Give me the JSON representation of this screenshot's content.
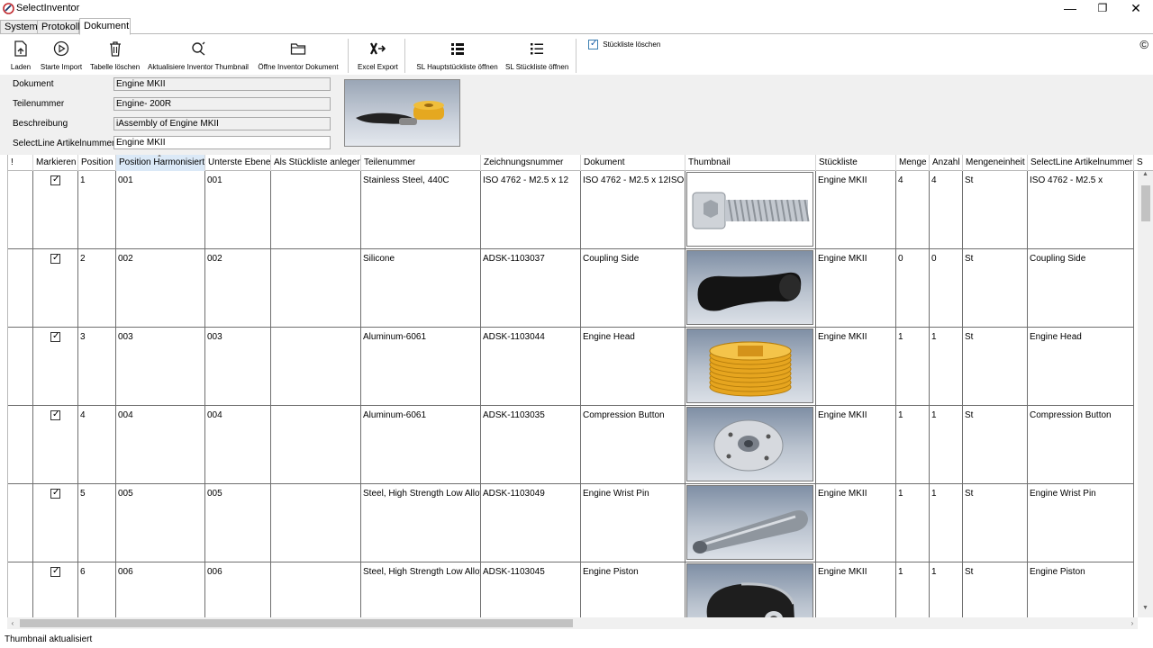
{
  "window": {
    "title": "SelectInventor",
    "minimize": "—",
    "maximize": "❐",
    "close": "✕"
  },
  "tabs": [
    {
      "label": "System"
    },
    {
      "label": "Protokoll"
    },
    {
      "label": "Dokument"
    }
  ],
  "toolbar": {
    "laden": "Laden",
    "starte_import": "Starte Import",
    "tabelle_loeschen": "Tabelle löschen",
    "aktualisiere_thumbnail": "Aktualisiere Inventor Thumbnail",
    "oeffne_dokument": "Öffne Inventor Dokument",
    "excel_export": "Excel Export",
    "sl_hauptstueckliste": "SL Hauptstückliste öffnen",
    "sl_stueckliste": "SL Stückliste öffnen",
    "stueckliste_loeschen": "Stückliste löschen",
    "stueckliste_loeschen_checked": true,
    "copyright": "©"
  },
  "fields": {
    "dokument_label": "Dokument",
    "dokument_value": "Engine MKII",
    "teilenummer_label": "Teilenummer",
    "teilenummer_value": "Engine- 200R",
    "beschreibung_label": "Beschreibung",
    "beschreibung_value": "iAssembly of Engine MKII",
    "artikelnummer_label": "SelectLine Artikelnummer",
    "artikelnummer_value": "Engine MKII"
  },
  "grid": {
    "columns": [
      "!",
      "Markieren",
      "Position",
      "Position Harmonisiert",
      "Unterste Ebene",
      "Als Stückliste anlegen",
      "Teilenummer",
      "Zeichnungsnummer",
      "Dokument",
      "Thumbnail",
      "Stückliste",
      "Menge",
      "Anzahl",
      "Mengeneinheit",
      "SelectLine Artikelnummer",
      "S"
    ],
    "rows": [
      {
        "checked": true,
        "position": "1",
        "harm": "001",
        "unterste": "001",
        "teil": "Stainless Steel, 440C",
        "zeichnung": "ISO 4762 - M2.5 x 12",
        "dokument": "ISO 4762 - M2.5 x 12ISO",
        "thumb": "screw",
        "stueck": "Engine MKII",
        "menge": "4",
        "anzahl": "4",
        "einheit": "St",
        "artikel": "ISO 4762 - M2.5 x"
      },
      {
        "checked": true,
        "position": "2",
        "harm": "002",
        "unterste": "002",
        "teil": "Silicone",
        "zeichnung": "ADSK-1103037",
        "dokument": "Coupling Side",
        "thumb": "coupling",
        "stueck": "Engine MKII",
        "menge": "0",
        "anzahl": "0",
        "einheit": "St",
        "artikel": "Coupling Side"
      },
      {
        "checked": true,
        "position": "3",
        "harm": "003",
        "unterste": "003",
        "teil": "Aluminum-6061",
        "zeichnung": "ADSK-1103044",
        "dokument": "Engine Head",
        "thumb": "head",
        "stueck": "Engine MKII",
        "menge": "1",
        "anzahl": "1",
        "einheit": "St",
        "artikel": "Engine Head"
      },
      {
        "checked": true,
        "position": "4",
        "harm": "004",
        "unterste": "004",
        "teil": "Aluminum-6061",
        "zeichnung": "ADSK-1103035",
        "dokument": "Compression Button",
        "thumb": "button",
        "stueck": "Engine MKII",
        "menge": "1",
        "anzahl": "1",
        "einheit": "St",
        "artikel": "Compression Button"
      },
      {
        "checked": true,
        "position": "5",
        "harm": "005",
        "unterste": "005",
        "teil": "Steel, High Strength Low Alloy",
        "zeichnung": "ADSK-1103049",
        "dokument": "Engine Wrist Pin",
        "thumb": "pin",
        "stueck": "Engine MKII",
        "menge": "1",
        "anzahl": "1",
        "einheit": "St",
        "artikel": "Engine Wrist Pin"
      },
      {
        "checked": true,
        "position": "6",
        "harm": "006",
        "unterste": "006",
        "teil": "Steel, High Strength Low Alloy",
        "zeichnung": "ADSK-1103045",
        "dokument": "Engine Piston",
        "thumb": "piston",
        "stueck": "Engine MKII",
        "menge": "1",
        "anzahl": "1",
        "einheit": "St",
        "artikel": "Engine Piston"
      }
    ]
  },
  "status": {
    "text": "Thumbnail aktualisiert"
  }
}
